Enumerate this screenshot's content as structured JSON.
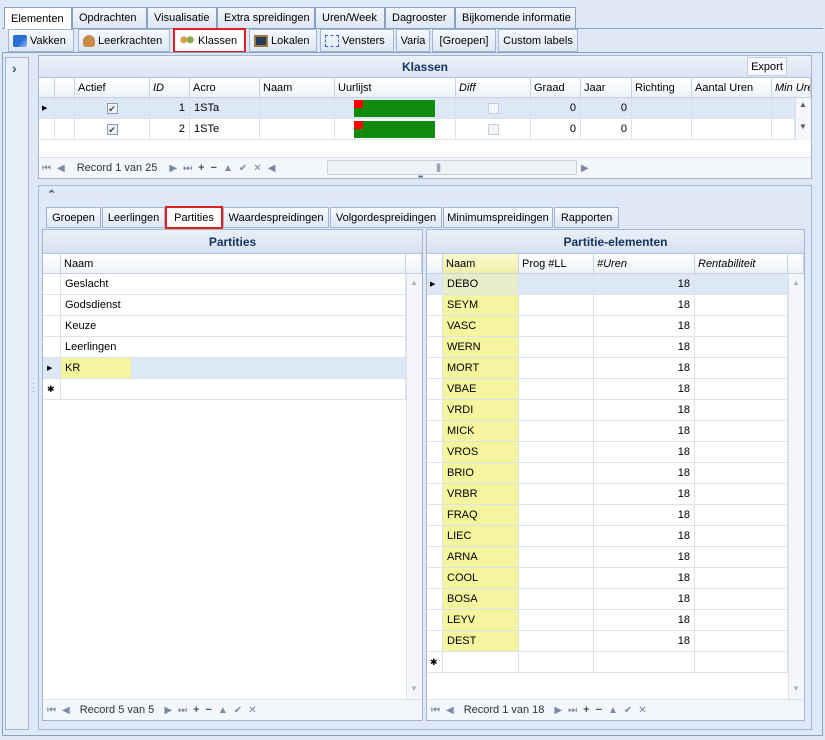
{
  "top_tabs": [
    "Elementen",
    "Opdrachten",
    "Visualisatie",
    "Extra spreidingen",
    "Uren/Week",
    "Dagrooster",
    "Bijkomende informatie"
  ],
  "sub_tabs": [
    "Vakken",
    "Leerkrachten",
    "Klassen",
    "Lokalen",
    "Vensters",
    "Varia",
    "[Groepen]",
    "Custom labels"
  ],
  "klassen": {
    "title": "Klassen",
    "export_label": "Export",
    "columns": [
      "Actief",
      "ID",
      "Acro",
      "Naam",
      "Uurlijst",
      "Diff",
      "Graad",
      "Jaar",
      "Richting",
      "Aantal Uren",
      "Min Uren"
    ],
    "rows": [
      {
        "id": "1",
        "acro": "1STa",
        "graad": "0",
        "jaar": "0"
      },
      {
        "id": "2",
        "acro": "1STe",
        "graad": "0",
        "jaar": "0"
      }
    ],
    "record_text": "Record 1 van 25",
    "scroll_grip": "|||"
  },
  "detail_tabs": [
    "Groepen",
    "Leerlingen",
    "Partities",
    "Waardespreidingen",
    "Volgordespreidingen",
    "Minimumspreidingen",
    "Rapporten"
  ],
  "partities": {
    "title": "Partities",
    "col_naam": "Naam",
    "rows": [
      "Geslacht",
      "Godsdienst",
      "Keuze",
      "Leerlingen",
      "KR"
    ],
    "record_text": "Record 5 van 5"
  },
  "elementen": {
    "title": "Partitie-elementen",
    "columns": [
      "Naam",
      "Prog #LL",
      "#Uren",
      "Rentabiliteit"
    ],
    "rows": [
      {
        "naam": "DEBO",
        "uren": "18"
      },
      {
        "naam": "SEYM",
        "uren": "18"
      },
      {
        "naam": "VASC",
        "uren": "18"
      },
      {
        "naam": "WERN",
        "uren": "18"
      },
      {
        "naam": "MORT",
        "uren": "18"
      },
      {
        "naam": "VBAE",
        "uren": "18"
      },
      {
        "naam": "VRDI",
        "uren": "18"
      },
      {
        "naam": "MICK",
        "uren": "18"
      },
      {
        "naam": "VROS",
        "uren": "18"
      },
      {
        "naam": "BRIO",
        "uren": "18"
      },
      {
        "naam": "VRBR",
        "uren": "18"
      },
      {
        "naam": "FRAQ",
        "uren": "18"
      },
      {
        "naam": "LIEC",
        "uren": "18"
      },
      {
        "naam": "ARNA",
        "uren": "18"
      },
      {
        "naam": "COOL",
        "uren": "18"
      },
      {
        "naam": "BOSA",
        "uren": "18"
      },
      {
        "naam": "LEYV",
        "uren": "18"
      },
      {
        "naam": "DEST",
        "uren": "18"
      }
    ],
    "record_text": "Record 1 van 18"
  },
  "glyphs": {
    "nav_first": "⏮",
    "nav_prev": "◀",
    "nav_next": "▶",
    "nav_next_page": "⏭",
    "nav_last": "⏭",
    "nav_add": "+",
    "nav_remove": "−",
    "nav_up": "▲",
    "nav_check": "✔",
    "nav_cancel": "✕",
    "row_pointer": "▶",
    "new_row": "✱",
    "expand": "›",
    "collapse": "⌃",
    "scroll_up": "▲",
    "scroll_down": "▼",
    "scroll_left": "◀",
    "scroll_right": "▶",
    "checkmark": "✔",
    "splitter": "•••"
  },
  "colors": {
    "accent": "#e02020",
    "uurlijst_bar": "#0e8a0e",
    "uurlijst_mark": "#ff0000",
    "highlight": "#f5f5a0",
    "selected_row": "#dde8f7"
  }
}
